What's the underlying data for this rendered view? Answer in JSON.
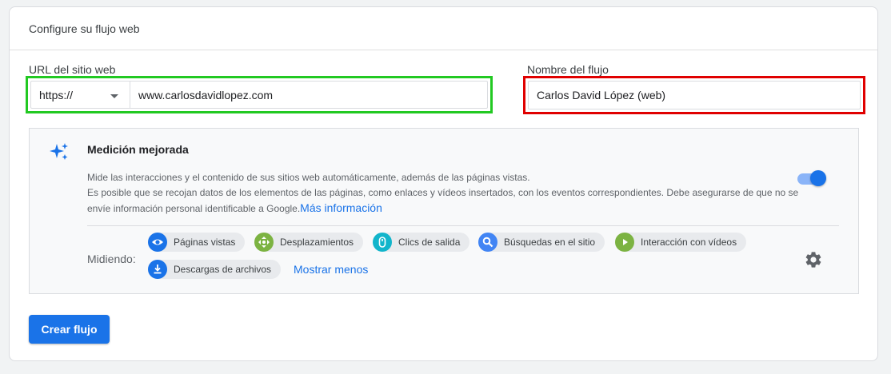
{
  "header": {
    "title": "Configure su flujo web"
  },
  "url_field": {
    "label": "URL del sitio web",
    "protocol": "https://",
    "value": "www.carlosdavidlopez.com"
  },
  "name_field": {
    "label": "Nombre del flujo",
    "value": "Carlos David López (web)"
  },
  "enhanced": {
    "title": "Medición mejorada",
    "desc_line1": "Mide las interacciones y el contenido de sus sitios web automáticamente, además de las páginas vistas.",
    "desc_line2": "Es posible que se recojan datos de los elementos de las páginas, como enlaces y vídeos insertados, con los eventos correspondientes. Debe asegurarse de que no se envíe información personal identificable a Google.",
    "more_link": "Más información",
    "toggle_on": true,
    "measuring_label": "Midiendo:",
    "chips": [
      {
        "label": "Páginas vistas",
        "icon": "eye-icon",
        "color": "#1a73e8"
      },
      {
        "label": "Desplazamientos",
        "icon": "move-icon",
        "color": "#7cb342"
      },
      {
        "label": "Clics de salida",
        "icon": "mouse-icon",
        "color": "#12b5cb"
      },
      {
        "label": "Búsquedas en el sitio",
        "icon": "search-icon",
        "color": "#4285f4"
      },
      {
        "label": "Interacción con vídeos",
        "icon": "play-icon",
        "color": "#7cb342"
      },
      {
        "label": "Descargas de archivos",
        "icon": "download-icon",
        "color": "#1a73e8"
      }
    ],
    "show_less": "Mostrar menos"
  },
  "create_button": "Crear flujo",
  "colors": {
    "accent": "#1a73e8",
    "highlight_green": "#22c922",
    "highlight_red": "#e00000"
  }
}
